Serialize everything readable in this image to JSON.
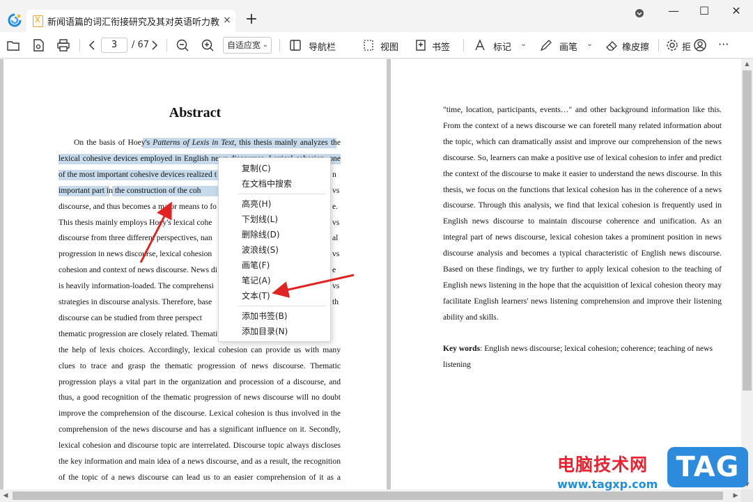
{
  "window": {
    "tab_title": "新闻语篇的词汇衔接研究及其对英语听力教...",
    "tab_close": "×",
    "new_tab": "+",
    "minimize": "—",
    "maximize": "☐",
    "close": "✕",
    "dropdown": "▾"
  },
  "toolbar": {
    "page_current": "3",
    "page_total": "/ 67",
    "zoom_mode": "自适应宽",
    "nav_label": "导航栏",
    "view_label": "视图",
    "bookmark_label": "书签",
    "mark_label": "标记",
    "pen_label": "画笔",
    "eraser_label": "橡皮擦",
    "settings_label": "拒",
    "more": "···"
  },
  "left_page": {
    "title": "Abstract",
    "lines": [
      "On the basis of Hoey's Patterns of Lexis in Text, this thesis mainly analyzes the",
      "lexical cohesive devices employed in English news discourses. Lexical cohesion, one",
      "of the most important cohesive devices realized t",
      "important part in the construction of the coh",
      "discourse, and thus becomes a major means to fo",
      "This thesis mainly employs Hoey's lexical cohe",
      "discourse from three different perspectives, nan",
      "progression in news discourse, lexical cohesion",
      "cohesion and context of news discourse. News di",
      "is heavily information-loaded. The comprehensi",
      "strategies in discourse analysis. Therefore, base",
      "discourse can be studied from three perspect",
      "thematic progression are closely related. Themati",
      "the help of lexis choices. Accordingly, lexical cohesion can provide us with many",
      "clues to trace and grasp the thematic progression of news discourse. Thematic",
      "progression plays a vital part in the organization and procession of a discourse, and",
      "thus, a good recognition of the thematic progression of news discourse will no doubt",
      "improve the comprehension of the discourse. Lexical cohesion is thus involved in the",
      "comprehension of the news discourse and has a significant influence on it. Secondly,",
      "lexical cohesion and discourse topic are interrelated. Discourse topic always discloses",
      "the key information and main idea of a news discourse, and as a result, the recognition",
      "of the topic of a news discourse can lead us to an easier comprehension of it as a"
    ],
    "right_edge_fragments": [
      "n",
      "vs",
      "e.",
      "vs",
      "al",
      "vs",
      "e",
      "vs",
      "th"
    ]
  },
  "right_page": {
    "lines": [
      "\"time, location, participants, events…\" and other background information like this.",
      "From the context of a news discourse we can foretell many related information about",
      "the topic, which can dramatically assist and improve our comprehension of the news",
      "discourse. So, learners can make a positive use of lexical cohesion to infer and predict",
      "the context of the discourse to make it easier to understand the news discourse. In this",
      "thesis, we focus on the functions that lexical cohesion has in the coherence of a news",
      "discourse. Through this analysis, we find that lexical cohesion is frequently used in",
      "English news discourse to maintain discourse coherence and unification. As an",
      "integral part of news discourse, lexical cohesion takes a prominent position in news",
      "discourse analysis and becomes a typical characteristic of English news discourse.",
      "Based on these findings, we try further to apply lexical cohesion to the teaching of",
      "English news listening in the hope that the acquisition of lexical cohesion theory may",
      "facilitate English learners' news listening comprehension and improve their listening",
      "ability and skills."
    ],
    "keywords_label": "Key words",
    "keywords_text": ": English news discourse; lexical cohesion; coherence; teaching of news",
    "keywords_text_2": "listening"
  },
  "context_menu": {
    "items": [
      "复制(C)",
      "在文档中搜索",
      "高亮(H)",
      "下划线(L)",
      "删除线(D)",
      "波浪线(S)",
      "画笔(F)",
      "笔记(A)",
      "文本(T)",
      "添加书签(B)",
      "添加目录(N)"
    ]
  },
  "watermark": {
    "text": "电脑技术网",
    "url": "www.tagxp.com",
    "logo": "TAG"
  },
  "colors": {
    "highlight": "#b3cde4",
    "arrow": "#e02424",
    "watermark_red": "#e8232f",
    "watermark_blue": "#2c8bdc"
  }
}
